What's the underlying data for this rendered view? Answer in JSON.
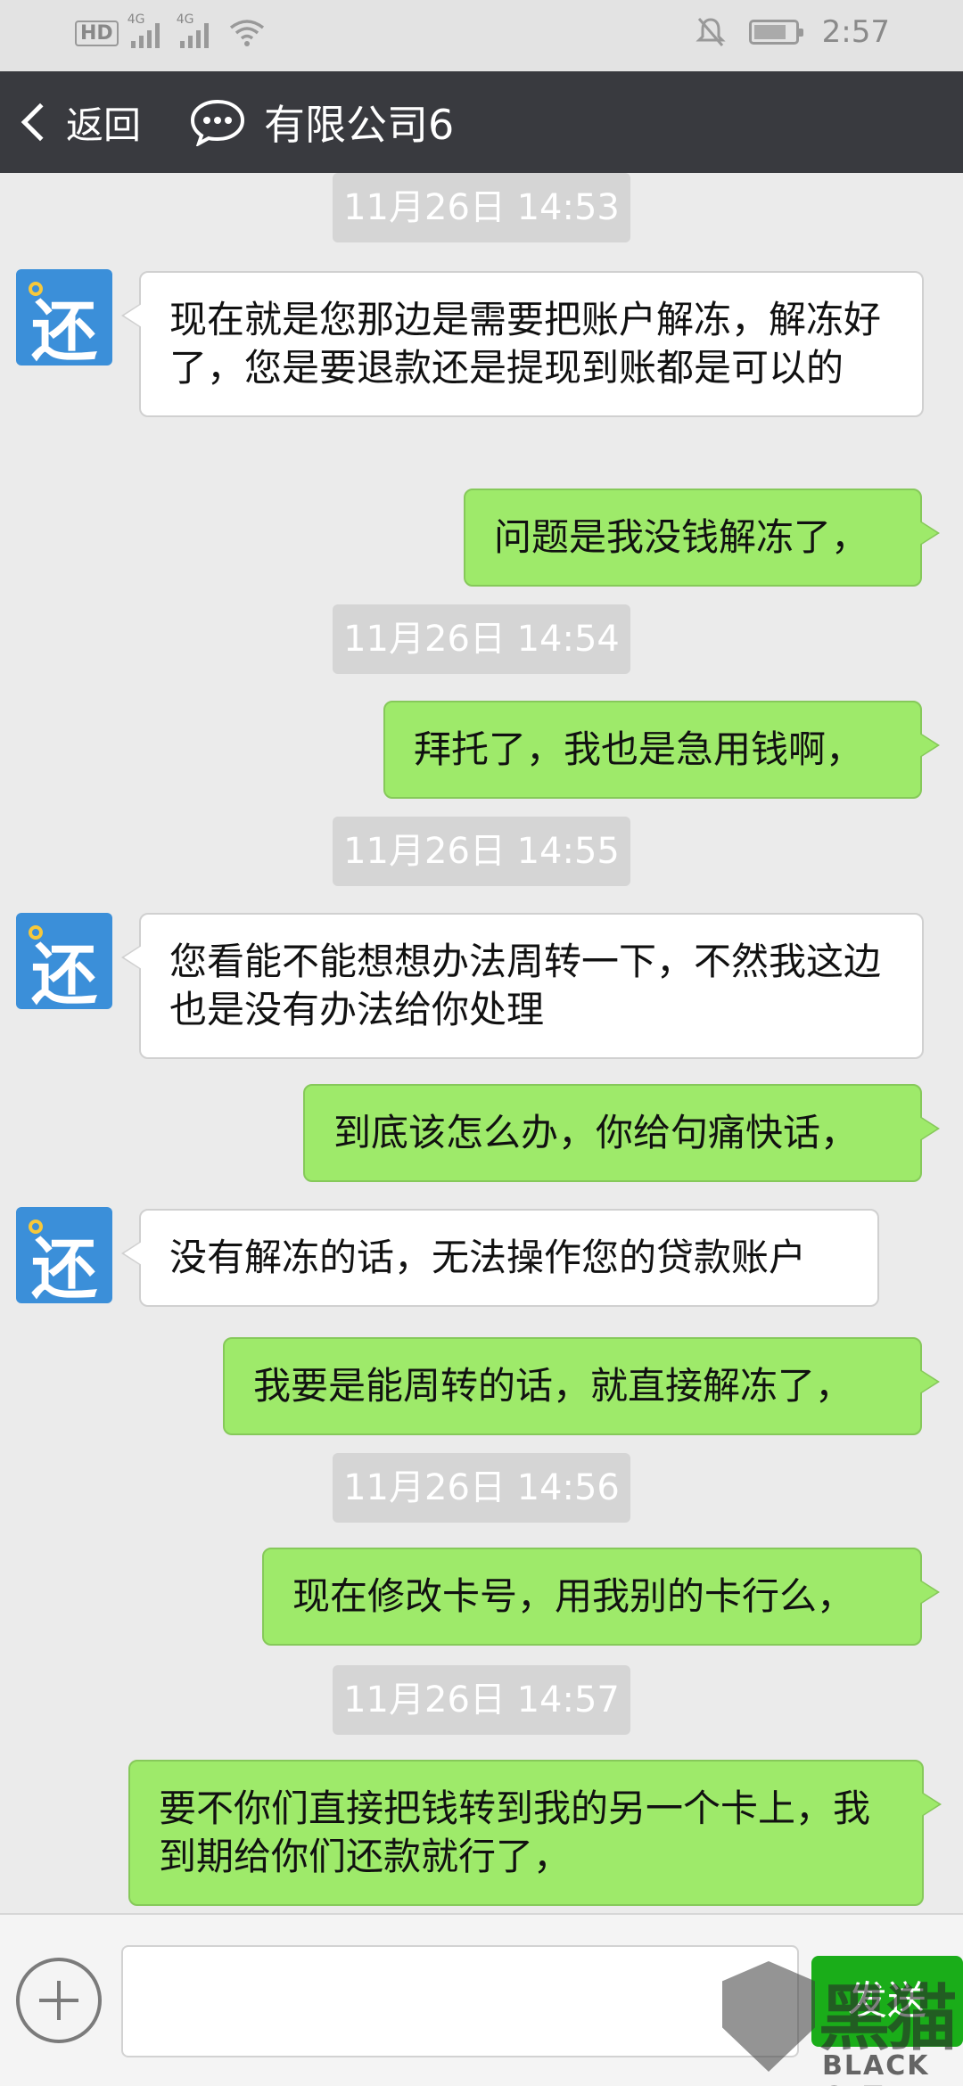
{
  "status_bar": {
    "hd_badge": "HD",
    "signal_1_label": "4G",
    "signal_2_label": "4G",
    "time": "2:57",
    "icons": [
      "hd-icon",
      "signal-icon",
      "signal-icon",
      "wifi-icon",
      "mute-bell-icon",
      "battery-icon"
    ]
  },
  "nav": {
    "back_label": "返回",
    "chat_icon": "chat-bubble-icon",
    "title": "有限公司6"
  },
  "messages": [
    {
      "type": "time",
      "text": "11月26日 14:53"
    },
    {
      "type": "received",
      "avatar_glyph": "还",
      "text": "现在就是您那边是需要把账户解冻，解冻好了，您是要退款还是提现到账都是可以的"
    },
    {
      "type": "sent",
      "text": "问题是我没钱解冻了，"
    },
    {
      "type": "time",
      "text": "11月26日 14:54"
    },
    {
      "type": "sent",
      "text": "拜托了，我也是急用钱啊，"
    },
    {
      "type": "time",
      "text": "11月26日 14:55"
    },
    {
      "type": "received",
      "avatar_glyph": "还",
      "text": "您看能不能想想办法周转一下，不然我这边也是没有办法给你处理"
    },
    {
      "type": "sent",
      "text": "到底该怎么办，你给句痛快话，"
    },
    {
      "type": "received",
      "avatar_glyph": "还",
      "text": "没有解冻的话，无法操作您的贷款账户"
    },
    {
      "type": "sent",
      "text": "我要是能周转的话，就直接解冻了，"
    },
    {
      "type": "time",
      "text": "11月26日 14:56"
    },
    {
      "type": "sent",
      "text": "现在修改卡号，用我别的卡行么，"
    },
    {
      "type": "time",
      "text": "11月26日 14:57"
    },
    {
      "type": "sent",
      "text": "要不你们直接把钱转到我的另一个卡上，我到期给你们还款就行了，"
    }
  ],
  "input_bar": {
    "add_icon": "plus-circle-icon",
    "input_value": "",
    "send_label": "发送"
  },
  "watermark": {
    "cn": "黑猫",
    "en": "BLACK CAT"
  },
  "colors": {
    "nav_bg": "#393a3f",
    "sent_bubble": "#9eea6a",
    "received_bubble": "#ffffff",
    "send_button": "#1aad19",
    "chat_bg": "#ebebeb",
    "avatar_bg": "#3b8fd9"
  }
}
